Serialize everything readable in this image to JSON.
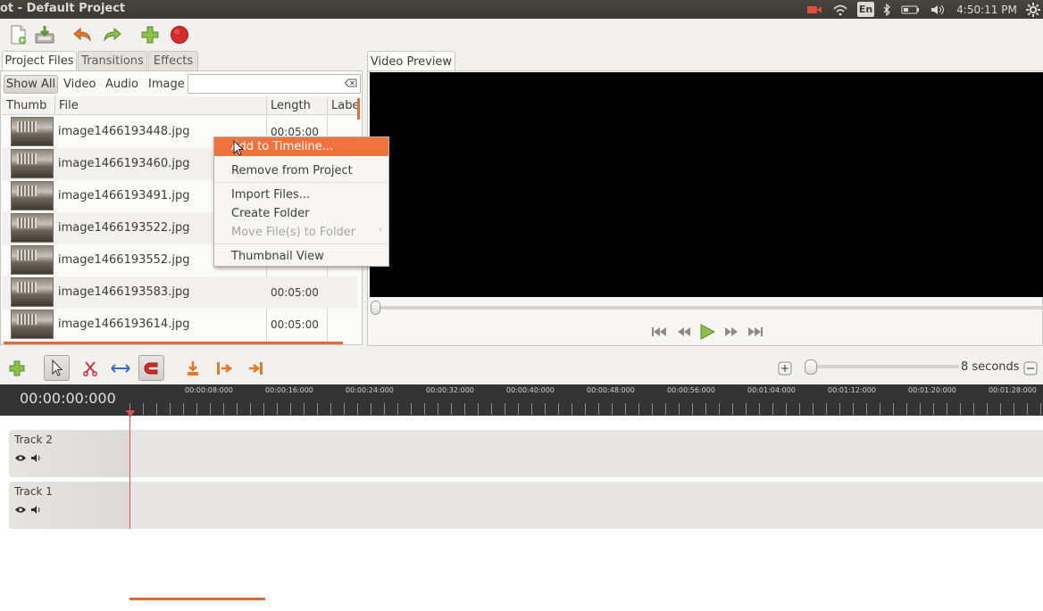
{
  "window": {
    "title": "ot - Default Project"
  },
  "tray": {
    "keyboard": "En",
    "clock": "4:50:11 PM"
  },
  "toolbar": {
    "icons": [
      "new-file-icon",
      "save-icon",
      "undo-icon",
      "redo-icon",
      "add-track-icon",
      "record-icon"
    ]
  },
  "project_tabs": [
    {
      "label": "Project Files"
    },
    {
      "label": "Transitions"
    },
    {
      "label": "Effects"
    }
  ],
  "filters": {
    "show_all": "Show All",
    "video": "Video",
    "audio": "Audio",
    "image": "Image",
    "search_value": ""
  },
  "columns": {
    "thumb": "Thumb",
    "file": "File",
    "length": "Length",
    "label": "Labe"
  },
  "files": [
    {
      "name": "image1466193448.jpg",
      "length": "00:05:00"
    },
    {
      "name": "image1466193460.jpg",
      "length": ""
    },
    {
      "name": "image1466193491.jpg",
      "length": ""
    },
    {
      "name": "image1466193522.jpg",
      "length": ""
    },
    {
      "name": "image1466193552.jpg",
      "length": ""
    },
    {
      "name": "image1466193583.jpg",
      "length": "00:05:00"
    },
    {
      "name": "image1466193614.jpg",
      "length": "00:05:00"
    }
  ],
  "context_menu": {
    "items": [
      {
        "label": "Add to Timeline..."
      },
      {
        "label": "Remove from Project"
      },
      {
        "label": "Import Files..."
      },
      {
        "label": "Create Folder"
      },
      {
        "label": "Move File(s) to Folder"
      },
      {
        "label": "Thumbnail View"
      }
    ]
  },
  "preview": {
    "tab": "Video Preview"
  },
  "timeline": {
    "zoom_label": "8 seconds",
    "timecode": "00:00:00:000",
    "ruler_labels": [
      "00:00:08:000",
      "00:00:16:000",
      "00:00:24:000",
      "00:00:32:000",
      "00:00:40:000",
      "00:00:48:000",
      "00:00:56:000",
      "00:01:04:000",
      "00:01:12:000",
      "00:01:20:000",
      "00:01:28:000"
    ],
    "tracks": [
      {
        "name": "Track 2"
      },
      {
        "name": "Track 1"
      }
    ]
  },
  "colors": {
    "accent": "#f0733f",
    "playhead": "#e05050",
    "ruler_bg": "#343434"
  }
}
